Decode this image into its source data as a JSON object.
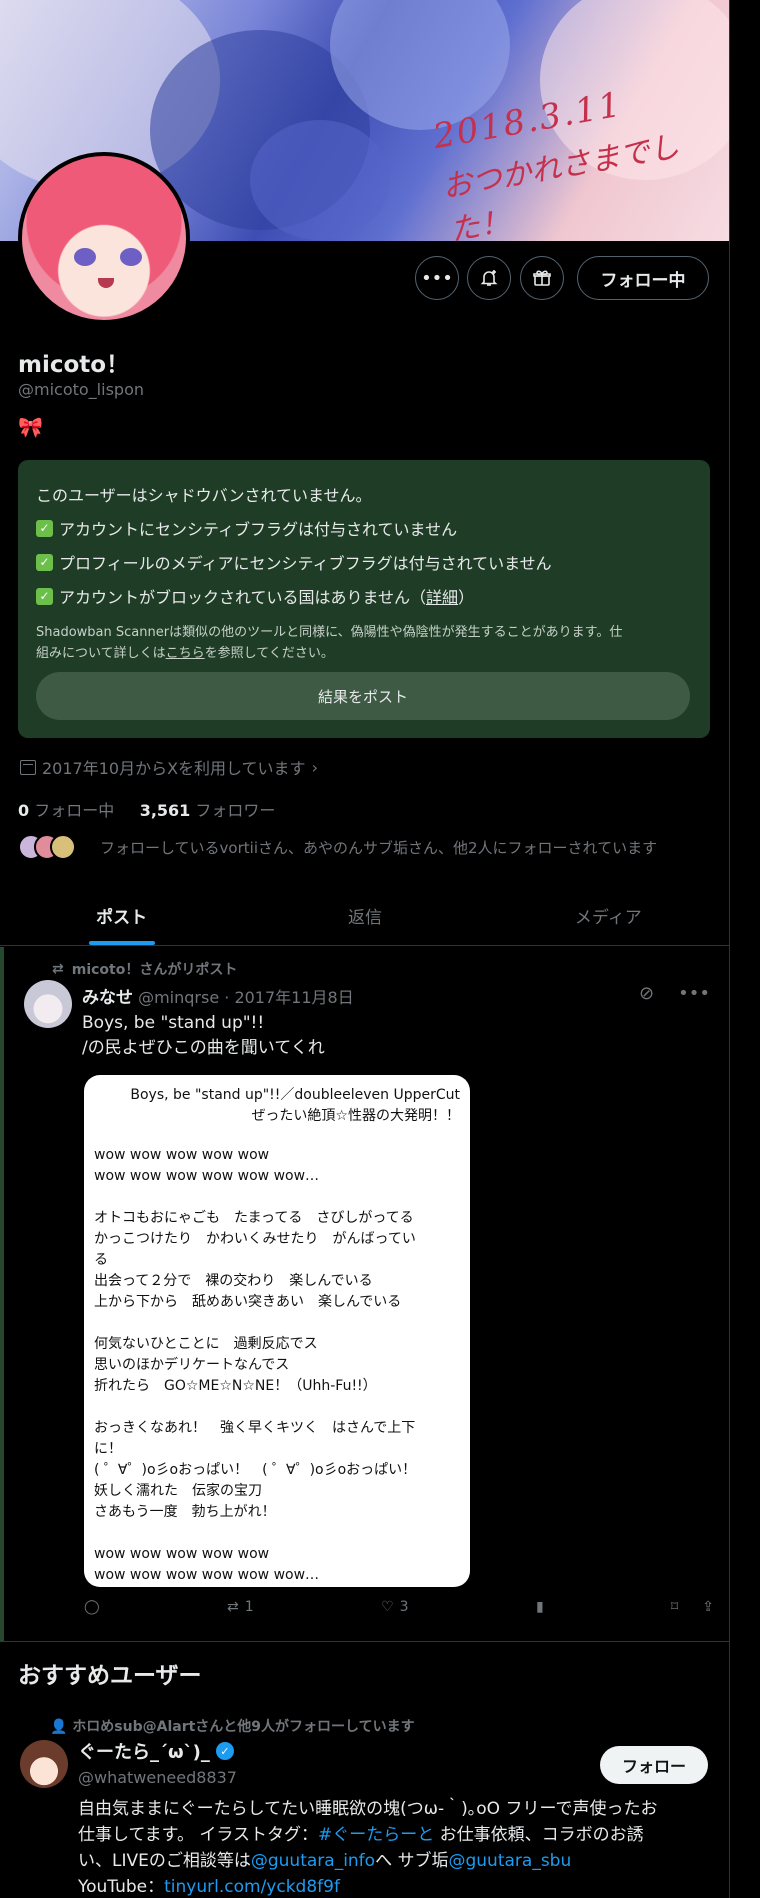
{
  "banner": {
    "date_text": "2018.3.11",
    "caption_text": "おつかれさまでした！"
  },
  "profile": {
    "name": "micoto！",
    "handle": "@micoto_lispon",
    "bio_emoji": "🎀",
    "follow_button": "フォロー中",
    "joined": "2017年10月からXを利用しています",
    "following_count": "0",
    "following_label": "フォロー中",
    "followers_count": "3,561",
    "followers_label": "フォロワー",
    "known_followers": "フォローしているvortiiさん、あやのんサブ垢さん、他2人にフォローされています"
  },
  "shadowban": {
    "title": "このユーザーはシャドウバンされていません。",
    "checks": [
      "アカウントにセンシティブフラグは付与されていません",
      "プロフィールのメディアにセンシティブフラグは付与されていません",
      "アカウントがブロックされている国はありません（"
    ],
    "details_link": "詳細",
    "details_close": "）",
    "note_1": "Shadowban Scannerは類似の他のツールと同様に、偽陽性や偽陰性が発生することがあります。仕",
    "note_2_a": "組みについて詳しくは",
    "note_2_link": "こちら",
    "note_2_b": "を参照してください。",
    "post_button": "結果をポスト"
  },
  "tabs": [
    "ポスト",
    "返信",
    "メディア"
  ],
  "post": {
    "repost_note": "micoto！さんがリポスト",
    "author": "みなせ",
    "meta": "@minqrse · 2017年11月8日",
    "text_1": "Boys, be \"stand up\"!!",
    "text_2": "/の民よぜひこの曲を聞いてくれ",
    "lyric_title_1": "Boys, be \"stand up\"!!／doubleeleven UpperCut",
    "lyric_title_2": "ぜったい絶頂☆性器の大発明！！",
    "lyric_body": "wow wow wow wow wow\nwow wow wow wow wow wow…\n\nオトコもおにゃごも　たまってる　さびしがってる\nかっこつけたり　かわいくみせたり　がんばってい\nる\n出会って２分で　裸の交わり　楽しんでいる\n上から下から　舐めあい突きあい　楽しんでいる\n\n何気ないひとことに　過剰反応でス\n思いのほかデリケートなんでス\n折れたら　GO☆ME☆N☆NE！（Uhh-Fu!!）\n\nおっきくなあれ！　強く早くキツく　はさんで上下\nに！\n( ゜∀゜)o彡oおっぱい！　( ゜∀゜)o彡oおっぱい！\n妖しく濡れた　伝家の宝刀\nさあもう一度　勃ち上がれ！\n\nwow wow wow wow wow\nwow wow wow wow wow wow…",
    "reposts": "1",
    "likes": "3"
  },
  "recommendations": {
    "title": "おすすめユーザー",
    "social": "ホロめsub@Alartさんと他9人がフォローしています",
    "name": "ぐーたら_´ω`)_",
    "handle": "@whatweneed8837",
    "follow_button": "フォロー",
    "bio_1": "自由気ままにぐーたらしてたい睡眠欲の塊(つω-｀)｡oO フリーで声使ったお",
    "bio_2a": "仕事してます。 イラストタグ：",
    "bio_2_tag": "#ぐーたらーと",
    "bio_2b": " お仕事依頼、コラボのお誘",
    "bio_3a": "い、LIVEのご相談等は",
    "bio_3_link1": "@guutara_info",
    "bio_3b": "へ サブ垢",
    "bio_3_link2": "@guutara_sbu",
    "bio_4a": "YouTube：",
    "bio_4_link": "tinyurl.com/yckd8f9f"
  },
  "colors": {
    "accent": "#1d9bf0",
    "card_bg": "#1f3d26",
    "check_green": "#6dbf4b"
  }
}
